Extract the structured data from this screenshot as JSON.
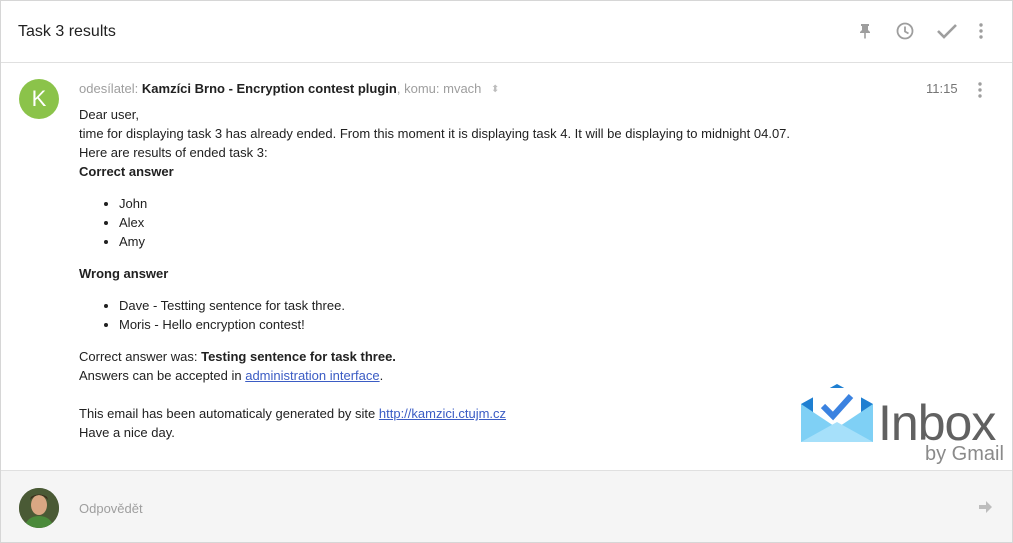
{
  "header": {
    "subject": "Task 3 results",
    "icons": [
      "pin-icon",
      "snooze-icon",
      "done-icon",
      "more-vert-icon"
    ]
  },
  "message": {
    "avatar_letter": "K",
    "avatar_color": "#8bc34a",
    "from_prefix": "odesílatel:",
    "sender": "Kamzíci Brno - Encryption contest plugin",
    "to_prefix": ", komu:",
    "recipient": "mvach",
    "time": "11:15",
    "body": {
      "greeting": "Dear user,",
      "line1": "time for displaying task 3 has already ended. From this moment it is displaying task 4. It will be displaying to midnight 04.07.",
      "line2": "Here are results of ended task 3:",
      "correct_heading": "Correct answer",
      "correct_list": [
        "John",
        "Alex",
        "Amy"
      ],
      "wrong_heading": "Wrong answer",
      "wrong_list": [
        "Dave - Testting sentence for task three.",
        "Moris - Hello encryption contest!"
      ],
      "answer_prefix": "Correct answer was: ",
      "answer_value": "Testing sentence for task three.",
      "accepted_prefix": "Answers can be accepted in ",
      "accepted_link": "administration interface",
      "accepted_suffix": ".",
      "generated_prefix": "This email has been automaticaly generated by site ",
      "generated_link": "http://kamzici.ctujm.cz",
      "closing": "Have a nice day."
    }
  },
  "watermark": {
    "word": "Inbox",
    "by": "by Gmail"
  },
  "reply": {
    "placeholder": "Odpovědět"
  }
}
